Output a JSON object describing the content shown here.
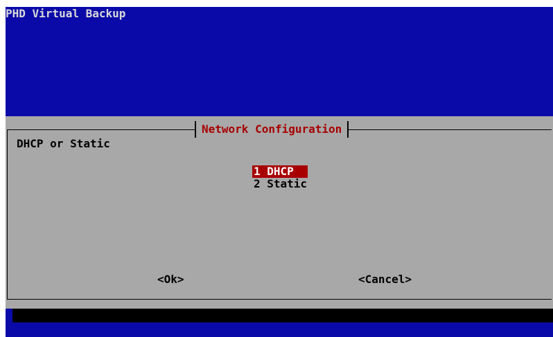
{
  "app": {
    "title": "PHD Virtual Backup"
  },
  "dialog": {
    "title": "Network Configuration",
    "prompt": "DHCP or Static",
    "options": [
      {
        "label": "1 DHCP",
        "selected": true
      },
      {
        "label": "2 Static",
        "selected": false
      }
    ],
    "buttons": {
      "ok": "<Ok>",
      "cancel": "<Cancel>"
    }
  },
  "colors": {
    "background": "#0a0aa8",
    "dialog": "#a8a8a8",
    "accent": "#a80000",
    "selected_text": "#ffffff"
  }
}
